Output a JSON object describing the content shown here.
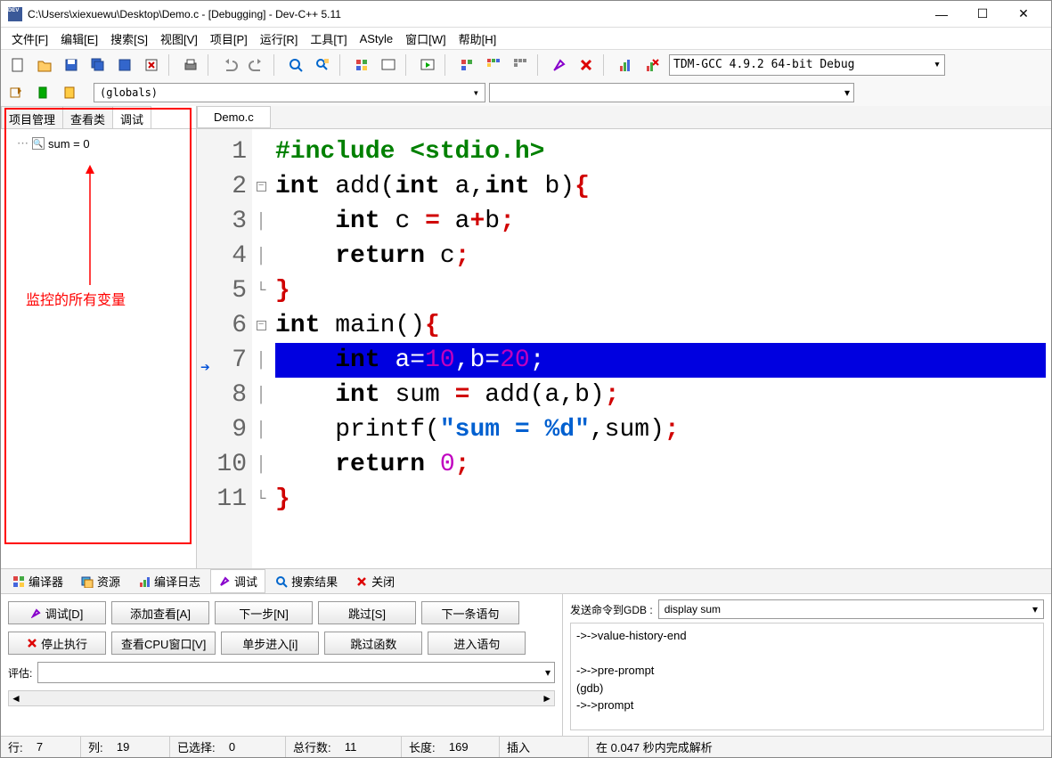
{
  "title": "C:\\Users\\xiexuewu\\Desktop\\Demo.c - [Debugging] - Dev-C++ 5.11",
  "menu": [
    "文件[F]",
    "编辑[E]",
    "搜索[S]",
    "视图[V]",
    "项目[P]",
    "运行[R]",
    "工具[T]",
    "AStyle",
    "窗口[W]",
    "帮助[H]"
  ],
  "compiler": "TDM-GCC 4.9.2 64-bit Debug",
  "globals": "(globals)",
  "sidebar_tabs": [
    "项目管理",
    "查看类",
    "调试"
  ],
  "sidebar_active": 2,
  "watch": {
    "expr": "sum = 0"
  },
  "annotation": "监控的所有变量",
  "editor_tab": "Demo.c",
  "code_lines": [
    {
      "n": 1,
      "html": "<span class='pp'>#include &lt;stdio.h&gt;</span>"
    },
    {
      "n": 2,
      "fold": "open",
      "html": "<span class='kw'>int</span> add(<span class='kw'>int</span> a,<span class='kw'>int</span> b)<span class='br'>{</span>"
    },
    {
      "n": 3,
      "html": "    <span class='kw'>int</span> c <span class='br'>=</span> a<span class='br'>+</span>b<span class='br'>;</span>"
    },
    {
      "n": 4,
      "html": "    <span class='kw'>return</span> c<span class='br'>;</span>"
    },
    {
      "n": 5,
      "fold": "end",
      "html": "<span class='br'>}</span>"
    },
    {
      "n": 6,
      "fold": "open",
      "html": "<span class='kw'>int</span> main()<span class='br'>{</span>"
    },
    {
      "n": 7,
      "current": true,
      "html": "    <span class='kw'>int</span> a=<span class='num'>10</span>,b=<span class='num'>20</span>;"
    },
    {
      "n": 8,
      "html": "    <span class='kw'>int</span> sum <span class='br'>=</span> add(a,b)<span class='br'>;</span>"
    },
    {
      "n": 9,
      "html": "    printf(<span class='str'>\"sum = %d\"</span>,sum)<span class='br'>;</span>"
    },
    {
      "n": 10,
      "html": "    <span class='kw'>return</span> <span class='num'>0</span><span class='br'>;</span>"
    },
    {
      "n": 11,
      "fold": "end",
      "html": "<span class='br'>}</span>"
    }
  ],
  "bottom_tabs": [
    {
      "icon": "compiler",
      "label": "编译器"
    },
    {
      "icon": "resource",
      "label": "资源"
    },
    {
      "icon": "log",
      "label": "编译日志"
    },
    {
      "icon": "debug",
      "label": "调试",
      "active": true
    },
    {
      "icon": "search",
      "label": "搜索结果"
    },
    {
      "icon": "close",
      "label": "关闭"
    }
  ],
  "debug_buttons_row1": [
    "调试[D]",
    "添加查看[A]",
    "下一步[N]",
    "跳过[S]",
    "下一条语句"
  ],
  "debug_buttons_row2": [
    "停止执行",
    "查看CPU窗口[V]",
    "单步进入[i]",
    "跳过函数",
    "进入语句"
  ],
  "eval_label": "评估:",
  "gdb_label": "发送命令到GDB :",
  "gdb_command": "display sum",
  "gdb_output": [
    "->->value-history-end",
    "",
    "->->pre-prompt",
    "(gdb)",
    "->->prompt"
  ],
  "status": {
    "line_label": "行:",
    "line": "7",
    "col_label": "列:",
    "col": "19",
    "sel_label": "已选择:",
    "sel": "0",
    "total_label": "总行数:",
    "total": "11",
    "len_label": "长度:",
    "len": "169",
    "mode": "插入",
    "parse": "在 0.047 秒内完成解析"
  }
}
